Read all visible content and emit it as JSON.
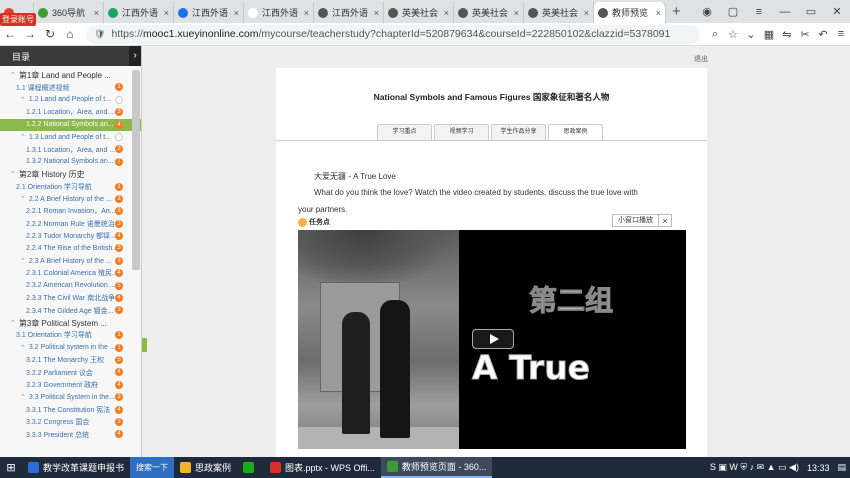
{
  "browser": {
    "login_badge": "登录账号",
    "tabs": [
      {
        "label": "",
        "color": "#e63b2e"
      },
      {
        "label": "360导航",
        "color": "#3b9d2f"
      },
      {
        "label": "江西外语",
        "color": "#1aa260"
      },
      {
        "label": "江西外语",
        "color": "#1a73e8"
      },
      {
        "label": "江西外语",
        "color": "#ffffff"
      },
      {
        "label": "江西外语",
        "color": "#555555"
      },
      {
        "label": "英美社会",
        "color": "#555555"
      },
      {
        "label": "英美社会",
        "color": "#555555"
      },
      {
        "label": "英美社会",
        "color": "#555555"
      },
      {
        "label": "教师预览",
        "color": "#555555"
      }
    ],
    "url_prefix": "https://",
    "url_host": "mooc1.xueyinonline.com",
    "url_path": "/mycourse/teacherstudy?chapterId=520879634&courseId=222850102&clazzid=5378091"
  },
  "sidebar": {
    "header": "目录",
    "items": [
      {
        "label": "第1章 Land and People ...",
        "type": "chapter",
        "num": ""
      },
      {
        "label": "1.1 课程概述视频",
        "type": "lvl1",
        "num": "1"
      },
      {
        "label": "1.2 Land and People of t...",
        "type": "lvl1c",
        "num": "·"
      },
      {
        "label": "1.2.1 Location，Area, and ...",
        "type": "lvl2",
        "num": "3"
      },
      {
        "label": "1.2.2 National Symbols an...",
        "type": "lvl2 active",
        "num": "4"
      },
      {
        "label": "1.3 Land and People of t...",
        "type": "lvl1c",
        "num": "·"
      },
      {
        "label": "1.3.1 Location，Area, and ...",
        "type": "lvl2",
        "num": "3"
      },
      {
        "label": "1.3.2 National Symbols an...",
        "type": "lvl2",
        "num": "7"
      },
      {
        "label": "第2章 History 历史",
        "type": "chapter",
        "num": ""
      },
      {
        "label": "2.1 Orientation 学习导航",
        "type": "lvl1",
        "num": "1"
      },
      {
        "label": "2.2 A Brief History of the ...",
        "type": "lvl1c",
        "num": "3"
      },
      {
        "label": "2.2.1 Roman Invasion，An...",
        "type": "lvl2",
        "num": "3"
      },
      {
        "label": "2.2.2 Norman Rule 诺曼统治",
        "type": "lvl2",
        "num": "3"
      },
      {
        "label": "2.2.3 Tudor Monarchy 都铎...",
        "type": "lvl2",
        "num": "4"
      },
      {
        "label": "2.2.4 The Rise of the British...",
        "type": "lvl2",
        "num": "3"
      },
      {
        "label": "2.3 A Brief History of the ...",
        "type": "lvl1c",
        "num": "3"
      },
      {
        "label": "2.3.1 Colonial America 殖民...",
        "type": "lvl2",
        "num": "4"
      },
      {
        "label": "2.3.2 American Revolution ...",
        "type": "lvl2",
        "num": "5"
      },
      {
        "label": "2.3.3 The Civil War 南北战争",
        "type": "lvl2",
        "num": "4"
      },
      {
        "label": "2.3.4 The Gilded Age 镀金...",
        "type": "lvl2",
        "num": "3"
      },
      {
        "label": "第3章 Political System ...",
        "type": "chapter",
        "num": ""
      },
      {
        "label": "3.1 Orientation 学习导航",
        "type": "lvl1",
        "num": "1"
      },
      {
        "label": "3.2 Political system in the ...",
        "type": "lvl1c",
        "num": "1"
      },
      {
        "label": "3.2.1 The Monarchy 王权",
        "type": "lvl2",
        "num": "5"
      },
      {
        "label": "3.2.2 Parliament 议会",
        "type": "lvl2",
        "num": "4"
      },
      {
        "label": "3.2.3 Government 政府",
        "type": "lvl2",
        "num": "4"
      },
      {
        "label": "3.3 Political System in the...",
        "type": "lvl1c",
        "num": "3"
      },
      {
        "label": "3.3.1 The Constitution 宪法",
        "type": "lvl2",
        "num": "4"
      },
      {
        "label": "3.3.2 Congress 国会",
        "type": "lvl2",
        "num": "3"
      },
      {
        "label": "3.3.3 President 总统",
        "type": "lvl2",
        "num": "4"
      }
    ]
  },
  "page": {
    "logout": "退出",
    "title": "National Symbols and Famous Figures 国家象征和著名人物",
    "tabs": [
      "学习重点",
      "视频学习",
      "学生作品分享",
      "思政案例"
    ],
    "active_tab": 3,
    "para1": "大爱无疆 - A  True Love",
    "para2": "What do you think the love? Watch the video created by students, discuss the true love with",
    "para3": "your partners.",
    "task_label": "任务点",
    "mini_window": "小窗口播放",
    "video_text1": "第二组",
    "video_text2": "A True"
  },
  "taskbar": {
    "apps": [
      {
        "label": "教学改革课题申报书",
        "color": "#2b6cd8"
      },
      {
        "label": "搜索一下",
        "color": "#2f6fc1"
      },
      {
        "label": "思政案例",
        "color": "#f0b429"
      },
      {
        "label": "",
        "color": "#1aad19"
      },
      {
        "label": "图表.pptx - WPS Offi...",
        "color": "#d93025"
      },
      {
        "label": "教师预览页面 - 360...",
        "color": "#3b9d2f"
      }
    ],
    "clock": "13:33"
  }
}
